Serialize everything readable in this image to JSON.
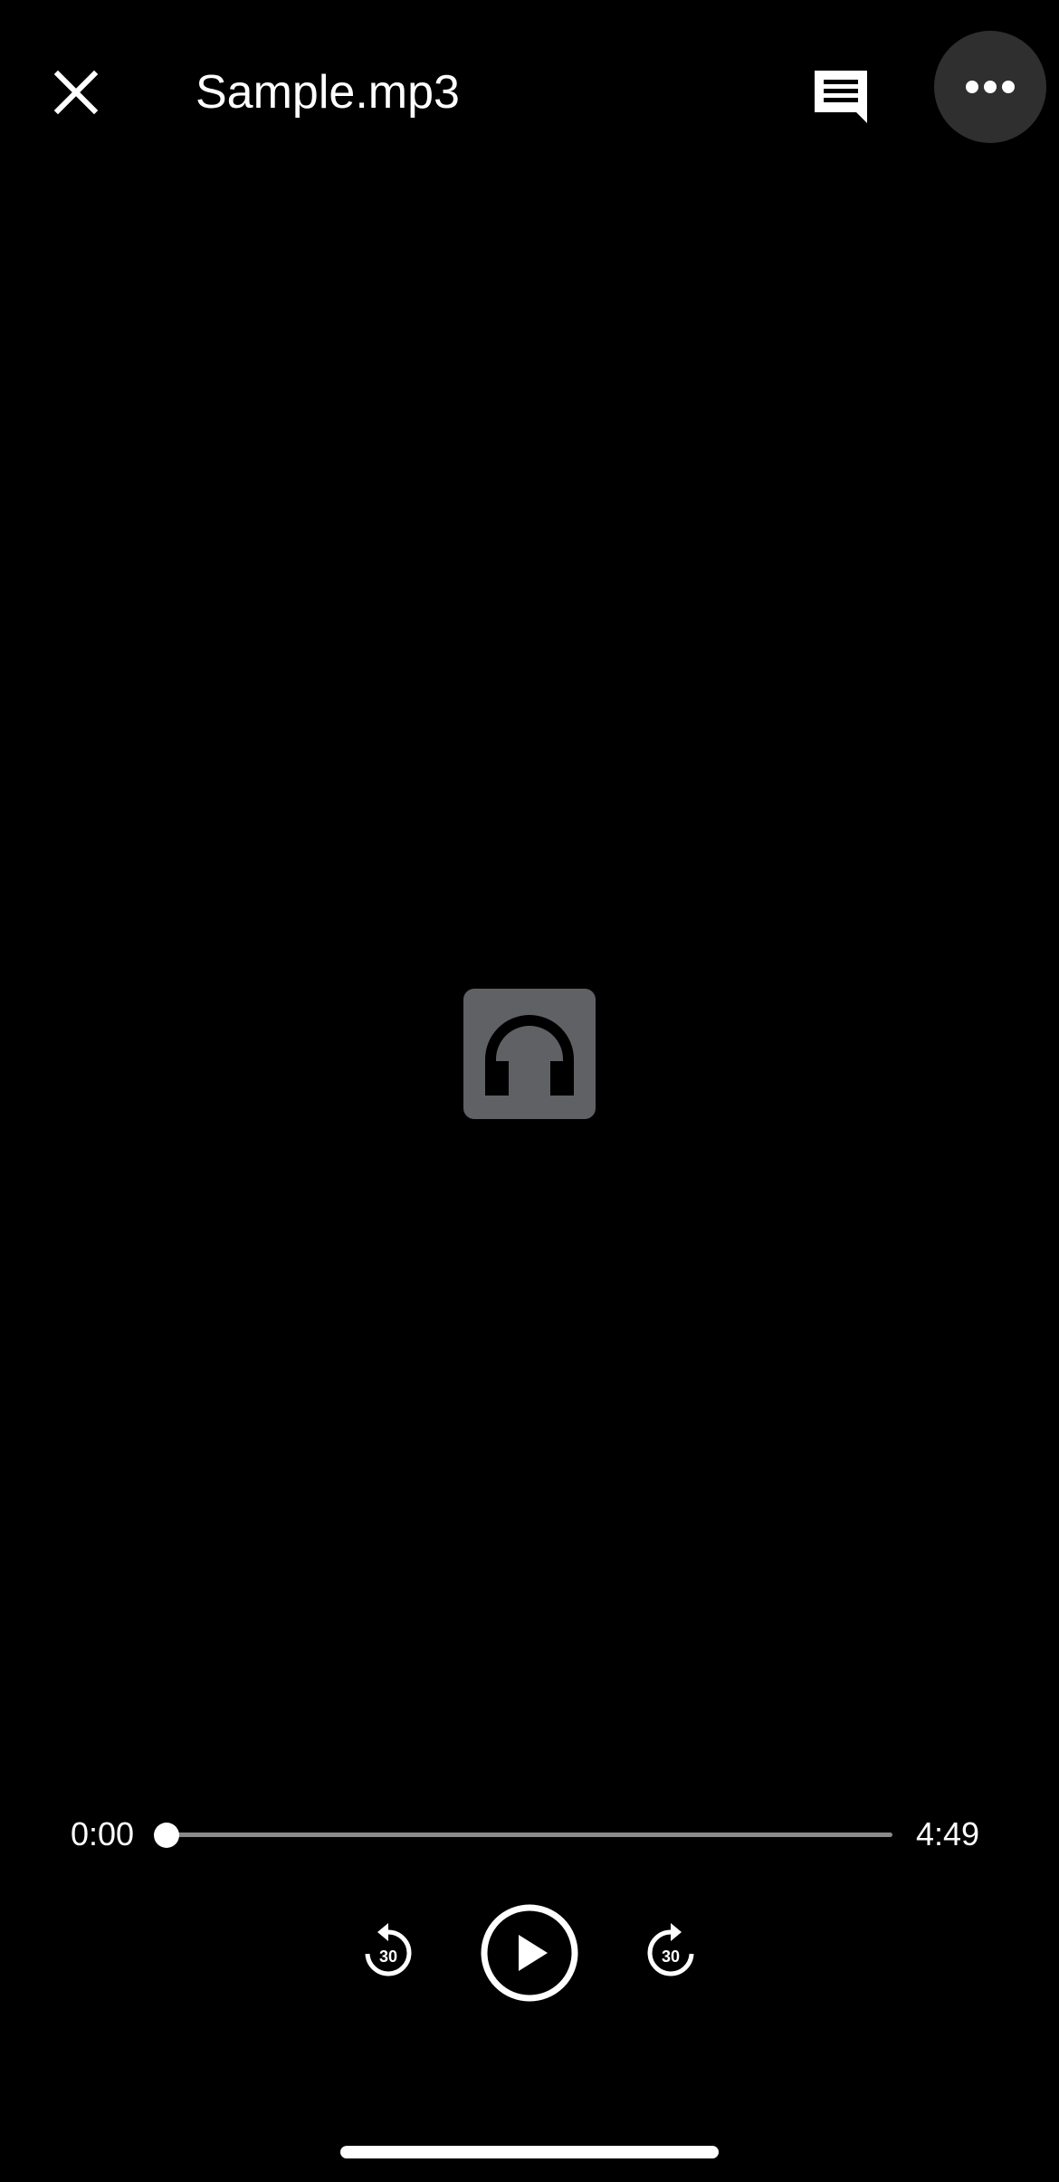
{
  "header": {
    "title": "Sample.mp3",
    "close_icon": "close-icon",
    "comments_icon": "comment-icon",
    "more_icon": "more-horizontal-icon"
  },
  "artwork": {
    "icon": "headphones-icon",
    "background_color": "#5f6165",
    "icon_color": "#000000"
  },
  "playback": {
    "current_time": "0:00",
    "total_time": "4:49",
    "progress_fraction": 0.0
  },
  "controls": {
    "rewind_icon": "replay-30-icon",
    "rewind_seconds": "30",
    "play_icon": "play-circle-icon",
    "forward_icon": "forward-30-icon",
    "forward_seconds": "30"
  },
  "colors": {
    "background": "#000000",
    "foreground": "#ffffff",
    "track": "#8a8a8a",
    "more_button_bg": "#2f2f2f"
  }
}
